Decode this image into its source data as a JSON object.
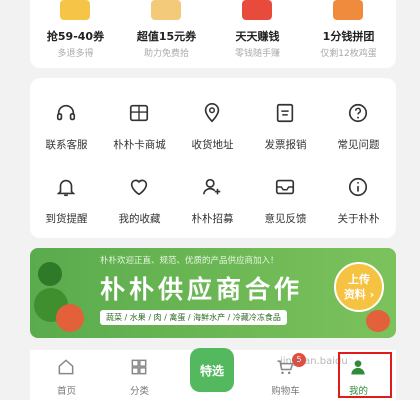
{
  "promos": [
    {
      "title": "抢59-40券",
      "subtitle": "多退多得",
      "color": "#f6c447"
    },
    {
      "title": "超值15元券",
      "subtitle": "助力免费拾",
      "color": "#f3c97a"
    },
    {
      "title": "天天赚钱",
      "subtitle": "零钱随手赚",
      "color": "#e84a3c"
    },
    {
      "title": "1分钱拼团",
      "subtitle": "仅剩12枚鸡蛋",
      "color": "#f08a3c"
    }
  ],
  "menu": [
    {
      "label": "联系客服",
      "icon": "headset-icon"
    },
    {
      "label": "朴朴卡商城",
      "icon": "gift-card-icon"
    },
    {
      "label": "收货地址",
      "icon": "location-icon"
    },
    {
      "label": "发票报销",
      "icon": "invoice-icon"
    },
    {
      "label": "常见问题",
      "icon": "help-icon"
    },
    {
      "label": "到货提醒",
      "icon": "bell-icon"
    },
    {
      "label": "我的收藏",
      "icon": "heart-icon"
    },
    {
      "label": "朴朴招募",
      "icon": "recruit-icon"
    },
    {
      "label": "意见反馈",
      "icon": "feedback-icon"
    },
    {
      "label": "关于朴朴",
      "icon": "info-icon"
    }
  ],
  "banner": {
    "subtitle": "朴朴欢迎正直、规范、优质的产品供应商加入！",
    "title": "朴朴供应商合作",
    "categories": "蔬菜 / 水果 / 肉 / 禽蛋 / 海鲜水产 / 冷藏冷冻食品",
    "button": "上传\n资料 ›"
  },
  "tabs": [
    {
      "label": "首页",
      "icon": "home-icon"
    },
    {
      "label": "分类",
      "icon": "grid-icon"
    },
    {
      "label": "特选",
      "icon": "basket-icon"
    },
    {
      "label": "购物车",
      "icon": "cart-icon",
      "badge": "5"
    },
    {
      "label": "我的",
      "icon": "profile-icon"
    }
  ],
  "watermark": "jingyan.baidu",
  "colors": {
    "brand_green": "#54b85f",
    "active_tab": "#2f8a3a",
    "highlight": "#e01b1b"
  }
}
